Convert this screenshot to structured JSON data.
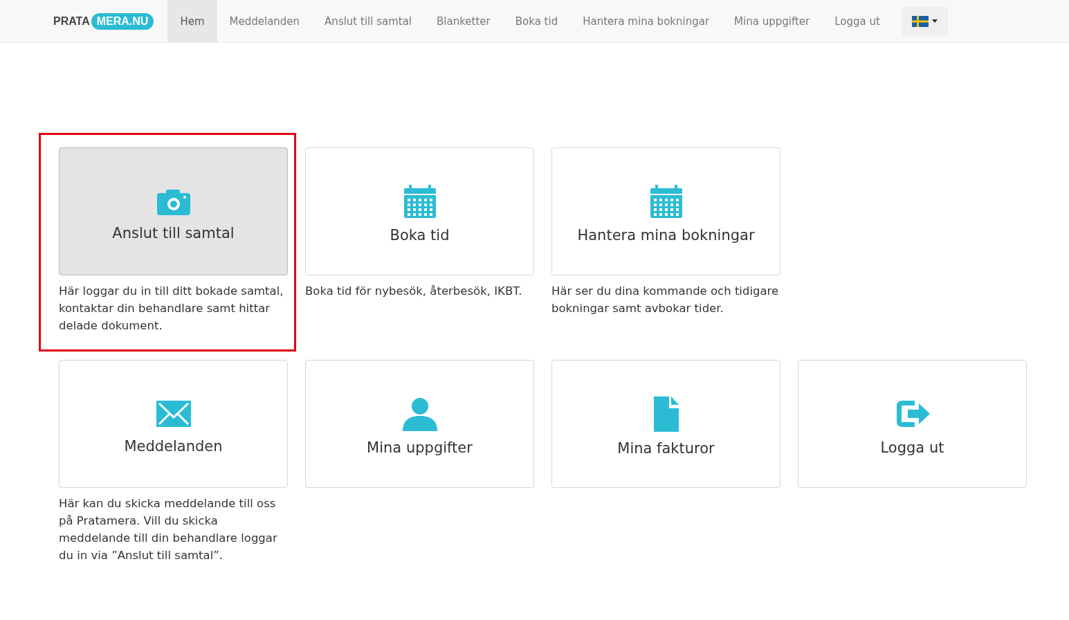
{
  "logo": {
    "left": "PRATA",
    "right": "MERA.NU"
  },
  "nav": [
    {
      "label": "Hem",
      "selected": true
    },
    {
      "label": "Meddelanden",
      "selected": false
    },
    {
      "label": "Anslut till samtal",
      "selected": false
    },
    {
      "label": "Blanketter",
      "selected": false
    },
    {
      "label": "Boka tid",
      "selected": false
    },
    {
      "label": "Hantera mina bokningar",
      "selected": false
    },
    {
      "label": "Mina uppgifter",
      "selected": false
    },
    {
      "label": "Logga ut",
      "selected": false
    }
  ],
  "tile_rows": [
    [
      {
        "title": "Anslut till samtal",
        "description": "Här loggar du in till ditt bokade samtal, kontaktar din behandlare samt hittar delade dokument.",
        "hovered": true,
        "highlighted": true
      },
      {
        "title": "Boka tid",
        "description": "Boka tid för nybesök, återbesök, IKBT.",
        "hovered": false,
        "highlighted": false
      },
      {
        "title": "Hantera mina bokningar",
        "description": "Här ser du dina kommande och tidigare bokningar samt avbokar tider.",
        "hovered": false,
        "highlighted": false
      }
    ],
    [
      {
        "title": "Meddelanden",
        "description": "Här kan du skicka meddelande till oss på Pratamera. Vill du skicka meddelande till din behandlare loggar du in via ”Anslut till samtal”.",
        "hovered": false,
        "highlighted": false
      },
      {
        "title": "Mina uppgifter",
        "hovered": false,
        "highlighted": false
      },
      {
        "title": "Mina fakturor",
        "hovered": false,
        "highlighted": false
      },
      {
        "title": "Logga ut",
        "hovered": false,
        "highlighted": false
      }
    ]
  ]
}
